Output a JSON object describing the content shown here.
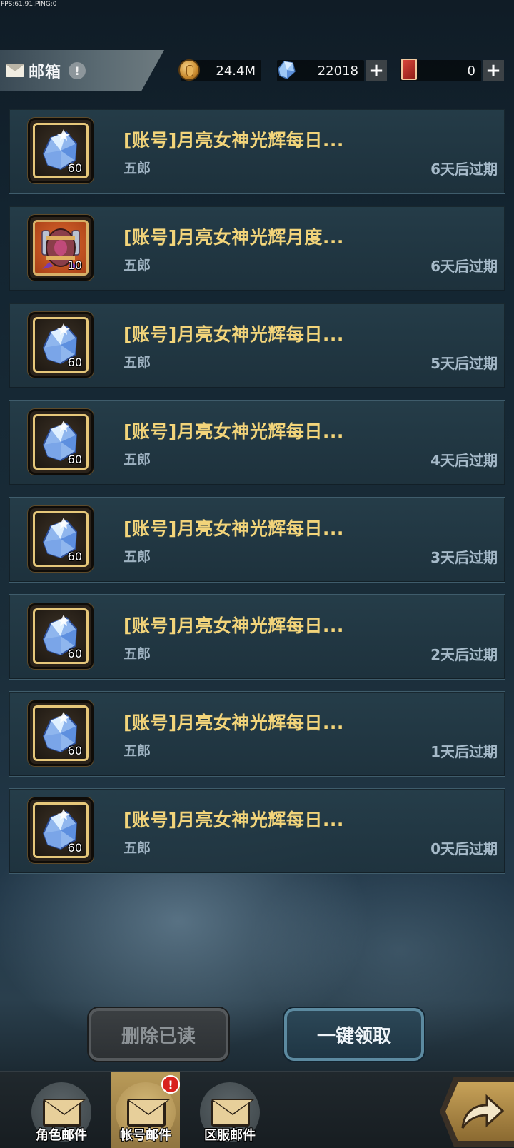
{
  "status": {
    "fps_text": "FPS:61.91,PING:0"
  },
  "header": {
    "title": "邮箱",
    "help_glyph": "!",
    "resources": {
      "gold": "24.4M",
      "diamond": "22018",
      "ticket": "0",
      "plus_glyph": "+"
    }
  },
  "mails": [
    {
      "title": "[账号]月亮女神光辉每日...",
      "sender": "五郎",
      "expire": "6天后过期",
      "item_icon": "crystal-icon",
      "qty": "60"
    },
    {
      "title": "[账号]月亮女神光辉月度...",
      "sender": "五郎",
      "expire": "6天后过期",
      "item_icon": "barrel-icon",
      "qty": "10"
    },
    {
      "title": "[账号]月亮女神光辉每日...",
      "sender": "五郎",
      "expire": "5天后过期",
      "item_icon": "crystal-icon",
      "qty": "60"
    },
    {
      "title": "[账号]月亮女神光辉每日...",
      "sender": "五郎",
      "expire": "4天后过期",
      "item_icon": "crystal-icon",
      "qty": "60"
    },
    {
      "title": "[账号]月亮女神光辉每日...",
      "sender": "五郎",
      "expire": "3天后过期",
      "item_icon": "crystal-icon",
      "qty": "60"
    },
    {
      "title": "[账号]月亮女神光辉每日...",
      "sender": "五郎",
      "expire": "2天后过期",
      "item_icon": "crystal-icon",
      "qty": "60"
    },
    {
      "title": "[账号]月亮女神光辉每日...",
      "sender": "五郎",
      "expire": "1天后过期",
      "item_icon": "crystal-icon",
      "qty": "60"
    },
    {
      "title": "[账号]月亮女神光辉每日...",
      "sender": "五郎",
      "expire": "0天后过期",
      "item_icon": "crystal-icon",
      "qty": "60"
    }
  ],
  "actions": {
    "delete_read": "删除已读",
    "claim_all": "一键领取"
  },
  "tabs": [
    {
      "label": "角色邮件",
      "icon": "envelope-icon",
      "active": false
    },
    {
      "label": "帐号邮件",
      "icon": "account-mail-icon",
      "active": true,
      "badge": "!"
    },
    {
      "label": "区服邮件",
      "icon": "server-mail-icon",
      "active": false
    }
  ],
  "colors": {
    "title_gold": "#f2d47a",
    "panel": "#263e4a",
    "accent_border": "#5c8aa0"
  }
}
